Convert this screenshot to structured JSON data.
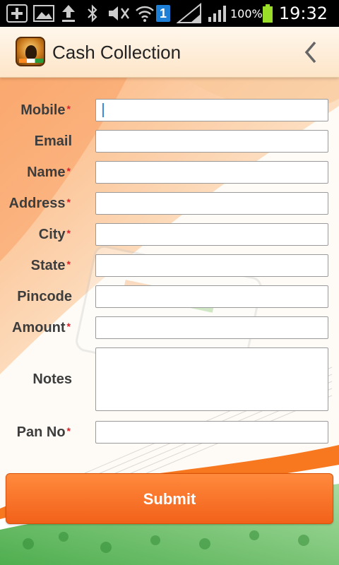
{
  "status_bar": {
    "battery_percent": "100%",
    "time": "19:32",
    "notification_badge": "1",
    "icons": [
      "add-icon",
      "image-icon",
      "upload-icon",
      "bluetooth-icon",
      "mute-icon",
      "wifi-icon",
      "sim-badge-icon",
      "signal-icon",
      "signal-icon-2",
      "battery-icon"
    ]
  },
  "action_bar": {
    "title": "Cash Collection",
    "back_icon": "back-chevron-icon"
  },
  "form": {
    "fields": [
      {
        "label": "Mobile",
        "required": true,
        "value": "",
        "placeholder": ""
      },
      {
        "label": "Email",
        "required": false,
        "value": "",
        "placeholder": ""
      },
      {
        "label": "Name",
        "required": true,
        "value": "",
        "placeholder": ""
      },
      {
        "label": "Address",
        "required": true,
        "value": "",
        "placeholder": ""
      },
      {
        "label": "City",
        "required": true,
        "value": "",
        "placeholder": ""
      },
      {
        "label": "State",
        "required": true,
        "value": "",
        "placeholder": ""
      },
      {
        "label": "Pincode",
        "required": false,
        "value": "",
        "placeholder": ""
      },
      {
        "label": "Amount",
        "required": true,
        "value": "",
        "placeholder": ""
      },
      {
        "label": "Notes",
        "required": false,
        "value": "",
        "placeholder": ""
      },
      {
        "label": "Pan No",
        "required": true,
        "value": "",
        "placeholder": ""
      }
    ],
    "required_marker": "*",
    "submit_label": "Submit"
  },
  "colors": {
    "accent_orange": "#f2611a",
    "required_red": "#e0202a",
    "saffron": "#ff8a1f",
    "green": "#2a9b3a"
  }
}
